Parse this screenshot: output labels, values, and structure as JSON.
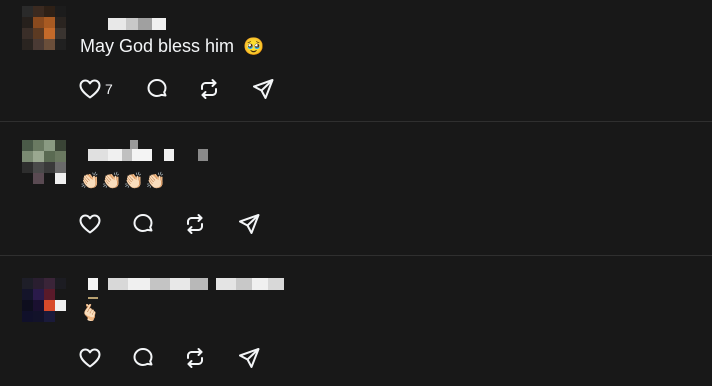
{
  "posts": [
    {
      "text": "May God bless him",
      "emoji": "🥹",
      "like_count": "7",
      "icons": [
        "heart-icon",
        "comment-icon",
        "repost-icon",
        "share-icon"
      ]
    },
    {
      "text": "",
      "emoji": "👏🏻👏🏻👏🏻👏🏻",
      "like_count": "",
      "icons": [
        "heart-icon",
        "comment-icon",
        "repost-icon",
        "share-icon"
      ]
    },
    {
      "text": "",
      "emoji": "🫰🏻",
      "like_count": "",
      "icons": [
        "heart-icon",
        "comment-icon",
        "repost-icon",
        "share-icon"
      ]
    }
  ],
  "colors": {
    "background": "#181818",
    "divider": "#2f2f2f",
    "text": "#f3f5f7"
  }
}
